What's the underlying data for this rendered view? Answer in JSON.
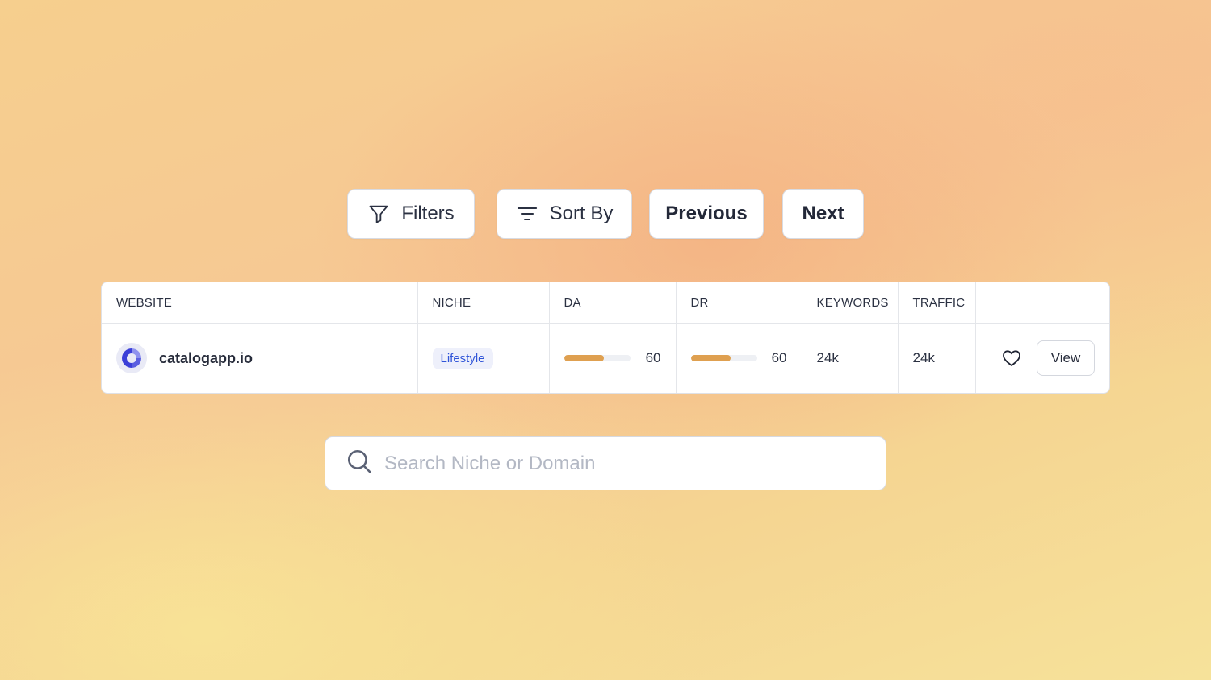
{
  "toolbar": {
    "filters_label": "Filters",
    "filters_icon": "filter-funnel-icon",
    "sort_label": "Sort By",
    "sort_icon": "sort-lines-icon",
    "previous_label": "Previous",
    "next_label": "Next"
  },
  "table": {
    "columns": [
      "WEBSITE",
      "NICHE",
      "DA",
      "DR",
      "KEYWORDS",
      "TRAFFIC"
    ],
    "rows": [
      {
        "website": "catalogapp.io",
        "logo_icon": "catalogapp-logo-icon",
        "niche": "Lifestyle",
        "da": "60",
        "da_fraction": 0.6,
        "dr": "60",
        "dr_fraction": 0.6,
        "keywords": "24k",
        "traffic": "24k",
        "favorite_icon": "heart-icon",
        "view_label": "View"
      }
    ]
  },
  "search": {
    "placeholder": "Search Niche or Domain",
    "value": "",
    "icon": "search-icon"
  },
  "colors": {
    "accent_bar": "#dfa050",
    "badge_text": "#2f54d8",
    "logo_blue": "#3b3fd8"
  }
}
